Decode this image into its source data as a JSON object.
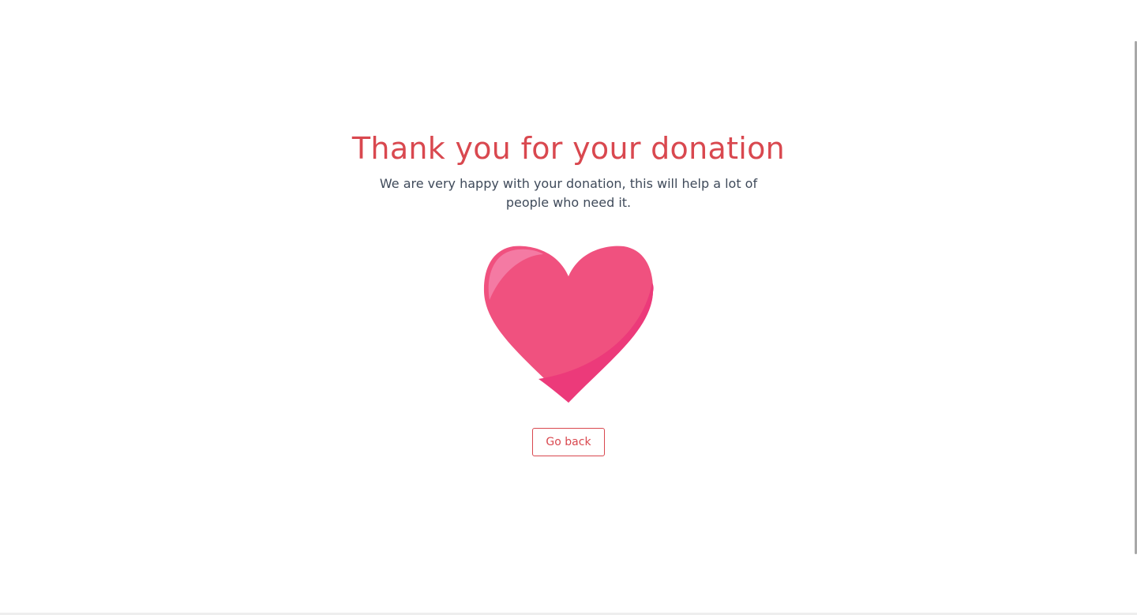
{
  "content": {
    "title": "Thank you for your donation",
    "message": "We are very happy with your donation, this will help a lot of people who need it.",
    "heart_icon": "heart-icon",
    "back_button_label": "Go back"
  },
  "colors": {
    "accent": "#d9484f",
    "heart": "#f0517f",
    "heart_shade": "#ec3a7a",
    "text": "#3f4a5a"
  }
}
